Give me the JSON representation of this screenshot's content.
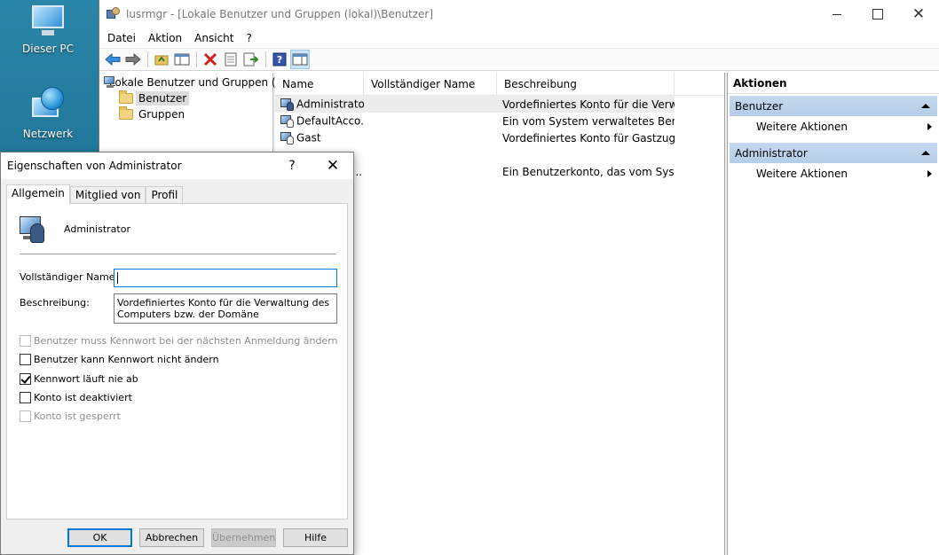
{
  "desktop": {
    "icons": [
      {
        "label": "Dieser PC",
        "icon": "this-pc-icon"
      },
      {
        "label": "Netzwerk",
        "icon": "network-icon"
      }
    ]
  },
  "window": {
    "title": "lusrmgr - [Lokale Benutzer und Gruppen (lokal)\\Benutzer]",
    "menu": [
      "Datei",
      "Aktion",
      "Ansicht",
      "?"
    ]
  },
  "tree": {
    "root": "Lokale Benutzer und Gruppen (lo",
    "children": [
      {
        "label": "Benutzer",
        "selected": true
      },
      {
        "label": "Gruppen",
        "selected": false
      }
    ]
  },
  "list": {
    "columns": [
      "Name",
      "Vollständiger Name",
      "Beschreibung"
    ],
    "rows": [
      {
        "name": "Administrator",
        "full": "",
        "desc": "Vordefiniertes Konto für die Verwa...",
        "selected": true
      },
      {
        "name": "DefaultAcco...",
        "full": "",
        "desc": "Ein vom System verwaltetes Benu...",
        "selected": false
      },
      {
        "name": "Gast",
        "full": "",
        "desc": "Vordefiniertes Konto für Gastzugri...",
        "selected": false
      },
      {
        "name": "",
        "full": "",
        "desc": "",
        "selected": false
      },
      {
        "name": "r...",
        "full": "",
        "desc": "Ein Benutzerkonto, das vom Syste...",
        "selected": false
      }
    ]
  },
  "actions": {
    "header": "Aktionen",
    "sections": [
      {
        "title": "Benutzer",
        "item": "Weitere Aktionen"
      },
      {
        "title": "Administrator",
        "item": "Weitere Aktionen"
      }
    ]
  },
  "dialog": {
    "title": "Eigenschaften von Administrator",
    "help": "?",
    "tabs": [
      "Allgemein",
      "Mitglied von",
      "Profil"
    ],
    "username": "Administrator",
    "full_name_label": "Vollständiger Name:",
    "full_name_value": "",
    "description_label": "Beschreibung:",
    "description_value": "Vordefiniertes Konto für die Verwaltung des Computers bzw. der Domäne",
    "checkboxes": [
      {
        "label": "Benutzer muss Kennwort bei der nächsten Anmeldung ändern",
        "checked": false,
        "disabled": true
      },
      {
        "label": "Benutzer kann Kennwort nicht ändern",
        "checked": false,
        "disabled": false
      },
      {
        "label": "Kennwort läuft nie ab",
        "checked": true,
        "disabled": false
      },
      {
        "label": "Konto ist deaktiviert",
        "checked": false,
        "disabled": false
      },
      {
        "label": "Konto ist gesperrt",
        "checked": false,
        "disabled": true
      }
    ],
    "buttons": {
      "ok": "OK",
      "cancel": "Abbrechen",
      "apply": "Übernehmen",
      "help": "Hilfe"
    }
  }
}
